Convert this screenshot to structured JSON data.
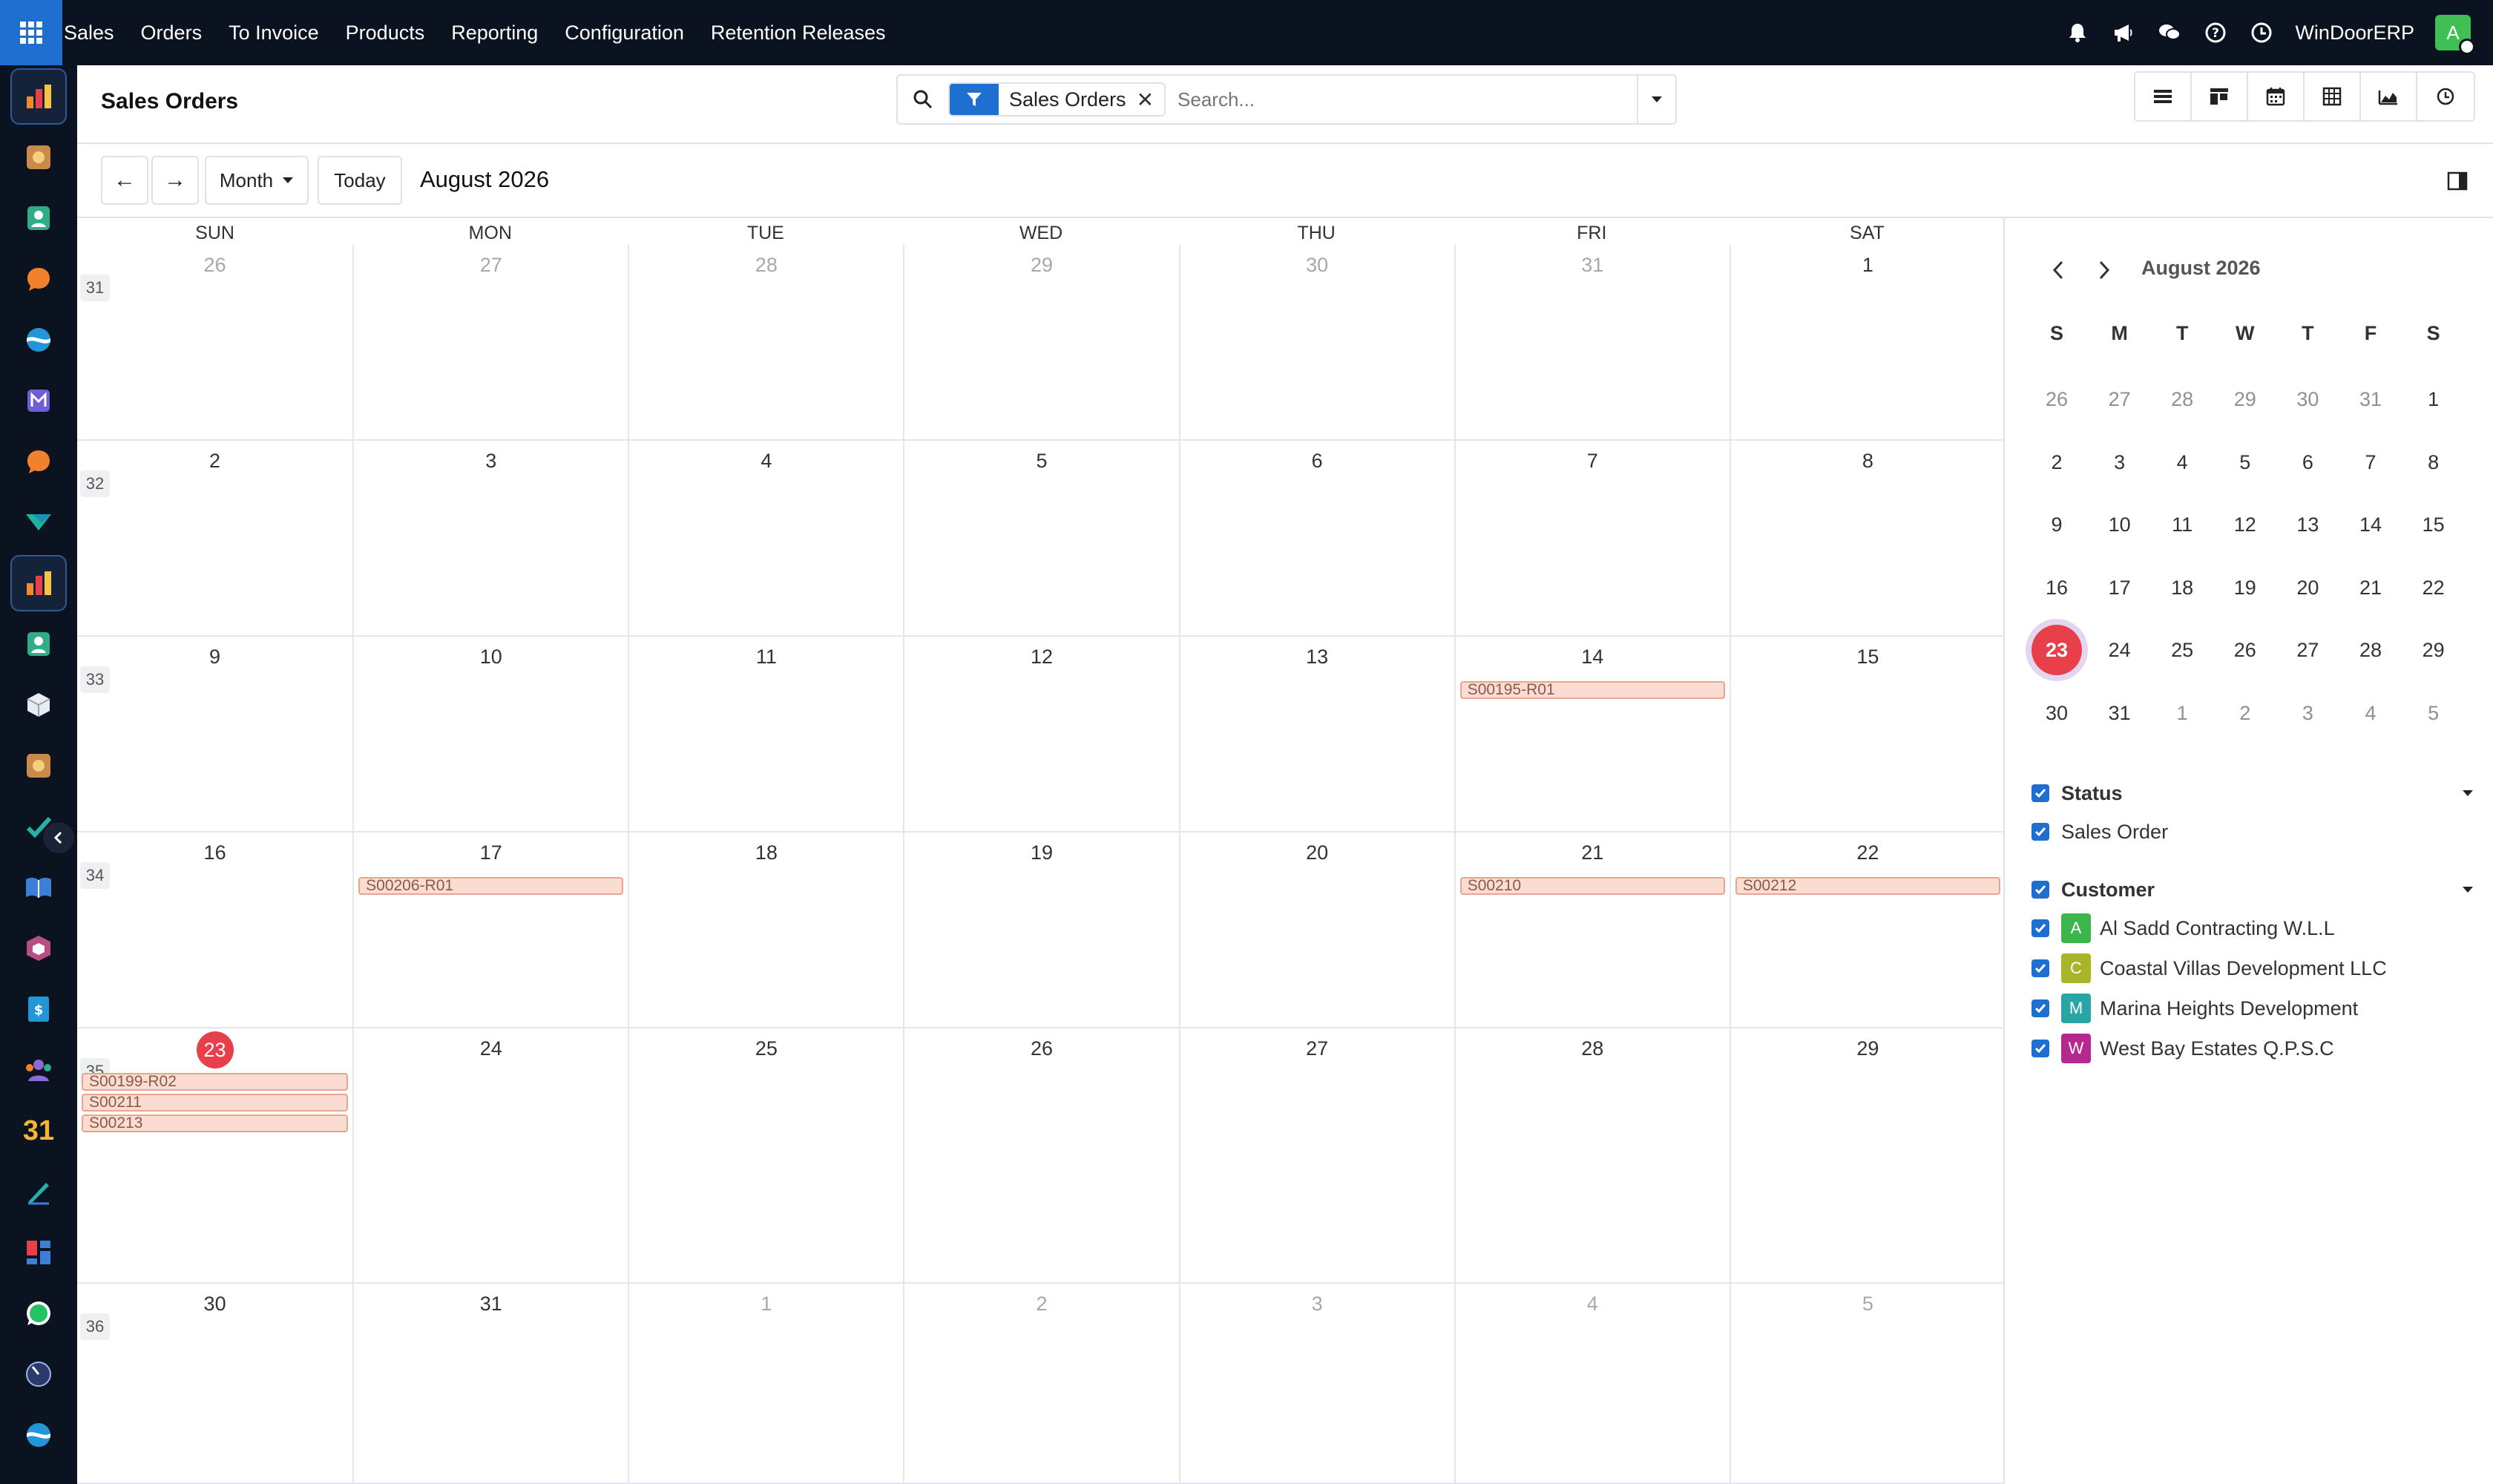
{
  "topbar": {
    "menu": [
      "Sales",
      "Orders",
      "To Invoice",
      "Products",
      "Reporting",
      "Configuration",
      "Retention Releases"
    ],
    "company": "WinDoorERP",
    "avatar_letter": "A",
    "icons": [
      "bell-icon",
      "megaphone-icon",
      "chat-icon",
      "help-icon",
      "clock-icon"
    ]
  },
  "leftbar": {
    "apps": [
      "sales-app-icon",
      "crm-app-icon",
      "contacts-app-icon",
      "discuss-app-icon",
      "project-app-icon",
      "mail-app-icon",
      "livechat-app-icon",
      "marketing-app-icon",
      "sales-app-icon-active",
      "contacts-app-icon-2",
      "inventory-app-icon",
      "crm-app-icon-2",
      "todo-app-icon",
      "knowledge-app-icon",
      "packages-app-icon",
      "invoicing-app-icon",
      "employees-app-icon",
      "calendar-app-icon",
      "sign-app-icon",
      "dashboards-app-icon",
      "whatsapp-app-icon",
      "timesheet-app-icon",
      "project-app-icon-2"
    ],
    "calendar_glyph": "31"
  },
  "control": {
    "title": "Sales Orders",
    "facet": "Sales Orders",
    "facet_remove": "✕",
    "search_placeholder": "Search...",
    "views": [
      "list-view-icon",
      "kanban-view-icon",
      "calendar-view-icon",
      "pivot-view-icon",
      "graph-view-icon",
      "activity-view-icon"
    ]
  },
  "nav": {
    "prev": "←",
    "next": "→",
    "scale": "Month",
    "today": "Today",
    "period": "August 2026"
  },
  "calendar": {
    "weekdays": [
      "SUN",
      "MON",
      "TUE",
      "WED",
      "THU",
      "FRI",
      "SAT"
    ],
    "weeks": [
      {
        "no": "31",
        "days": [
          {
            "d": "26",
            "o": true
          },
          {
            "d": "27",
            "o": true
          },
          {
            "d": "28",
            "o": true
          },
          {
            "d": "29",
            "o": true
          },
          {
            "d": "30",
            "o": true
          },
          {
            "d": "31",
            "o": true
          },
          {
            "d": "1",
            "o": false
          }
        ]
      },
      {
        "no": "32",
        "days": [
          {
            "d": "2",
            "o": false
          },
          {
            "d": "3",
            "o": false
          },
          {
            "d": "4",
            "o": false
          },
          {
            "d": "5",
            "o": false
          },
          {
            "d": "6",
            "o": false
          },
          {
            "d": "7",
            "o": false
          },
          {
            "d": "8",
            "o": false
          }
        ]
      },
      {
        "no": "33",
        "days": [
          {
            "d": "9",
            "o": false
          },
          {
            "d": "10",
            "o": false
          },
          {
            "d": "11",
            "o": false
          },
          {
            "d": "12",
            "o": false
          },
          {
            "d": "13",
            "o": false
          },
          {
            "d": "14",
            "o": false,
            "events": [
              "S00195-R01"
            ]
          },
          {
            "d": "15",
            "o": false
          }
        ]
      },
      {
        "no": "34",
        "days": [
          {
            "d": "16",
            "o": false
          },
          {
            "d": "17",
            "o": false,
            "events": [
              "S00206-R01"
            ]
          },
          {
            "d": "18",
            "o": false
          },
          {
            "d": "19",
            "o": false
          },
          {
            "d": "20",
            "o": false
          },
          {
            "d": "21",
            "o": false,
            "events": [
              "S00210"
            ]
          },
          {
            "d": "22",
            "o": false,
            "events": [
              "S00212"
            ]
          }
        ]
      },
      {
        "no": "35",
        "days": [
          {
            "d": "23",
            "o": false,
            "today": true,
            "events": [
              "S00199-R02",
              "S00211",
              "S00213"
            ]
          },
          {
            "d": "24",
            "o": false
          },
          {
            "d": "25",
            "o": false
          },
          {
            "d": "26",
            "o": false
          },
          {
            "d": "27",
            "o": false
          },
          {
            "d": "28",
            "o": false
          },
          {
            "d": "29",
            "o": false
          }
        ]
      },
      {
        "no": "36",
        "days": [
          {
            "d": "30",
            "o": false
          },
          {
            "d": "31",
            "o": false
          },
          {
            "d": "1",
            "o": true
          },
          {
            "d": "2",
            "o": true
          },
          {
            "d": "3",
            "o": true
          },
          {
            "d": "4",
            "o": true
          },
          {
            "d": "5",
            "o": true
          }
        ]
      }
    ]
  },
  "mini": {
    "title": "August 2026",
    "weekdays": [
      "S",
      "M",
      "T",
      "W",
      "T",
      "F",
      "S"
    ],
    "rows": [
      [
        {
          "d": "26",
          "o": true
        },
        {
          "d": "27",
          "o": true
        },
        {
          "d": "28",
          "o": true
        },
        {
          "d": "29",
          "o": true
        },
        {
          "d": "30",
          "o": true
        },
        {
          "d": "31",
          "o": true
        },
        {
          "d": "1",
          "o": false
        }
      ],
      [
        {
          "d": "2"
        },
        {
          "d": "3"
        },
        {
          "d": "4"
        },
        {
          "d": "5"
        },
        {
          "d": "6"
        },
        {
          "d": "7"
        },
        {
          "d": "8"
        }
      ],
      [
        {
          "d": "9"
        },
        {
          "d": "10"
        },
        {
          "d": "11"
        },
        {
          "d": "12"
        },
        {
          "d": "13"
        },
        {
          "d": "14"
        },
        {
          "d": "15"
        }
      ],
      [
        {
          "d": "16"
        },
        {
          "d": "17"
        },
        {
          "d": "18"
        },
        {
          "d": "19"
        },
        {
          "d": "20"
        },
        {
          "d": "21"
        },
        {
          "d": "22"
        }
      ],
      [
        {
          "d": "23",
          "today": true
        },
        {
          "d": "24"
        },
        {
          "d": "25"
        },
        {
          "d": "26"
        },
        {
          "d": "27"
        },
        {
          "d": "28"
        },
        {
          "d": "29"
        }
      ],
      [
        {
          "d": "30"
        },
        {
          "d": "31"
        },
        {
          "d": "1",
          "o": true
        },
        {
          "d": "2",
          "o": true
        },
        {
          "d": "3",
          "o": true
        },
        {
          "d": "4",
          "o": true
        },
        {
          "d": "5",
          "o": true
        }
      ]
    ]
  },
  "filters": {
    "status": {
      "label": "Status",
      "items": [
        {
          "label": "Sales Order"
        }
      ]
    },
    "customer": {
      "label": "Customer",
      "items": [
        {
          "letter": "A",
          "label": "Al Sadd Contracting W.L.L",
          "color": "#3cb54a"
        },
        {
          "letter": "C",
          "label": "Coastal Villas Development LLC",
          "color": "#a7b52a"
        },
        {
          "letter": "M",
          "label": "Marina Heights Development",
          "color": "#2aa5a5"
        },
        {
          "letter": "W",
          "label": "West Bay Estates Q.P.S.C",
          "color": "#b5298f"
        }
      ]
    }
  },
  "colors": {
    "accent": "#1f6fd0",
    "today": "#e7404a",
    "event_bg": "#fadcd0",
    "topbar": "#0b1220"
  }
}
